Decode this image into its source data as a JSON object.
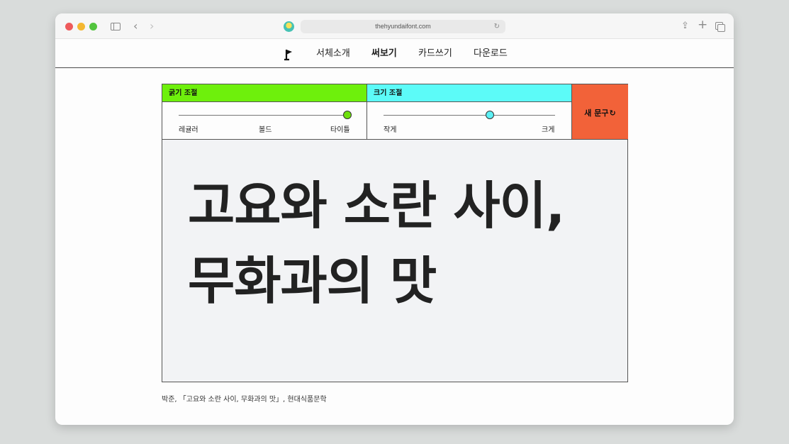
{
  "browser": {
    "url": "thehyundaifont.com"
  },
  "nav": {
    "items": [
      {
        "label": "서체소개",
        "active": false
      },
      {
        "label": "써보기",
        "active": true
      },
      {
        "label": "카드쓰기",
        "active": false
      },
      {
        "label": "다운로드",
        "active": false
      }
    ]
  },
  "controls": {
    "weight": {
      "title": "굵기 조절",
      "labels": [
        "레귤러",
        "볼드",
        "타이틀"
      ],
      "value_fraction": 1.0,
      "color": "#6ef00c"
    },
    "size": {
      "title": "크기 조절",
      "labels": [
        "작게",
        "크게"
      ],
      "value_fraction": 0.62,
      "color": "#5cfbf8"
    },
    "new_text_button": {
      "label": "새 문구",
      "color": "#f26239"
    }
  },
  "preview": {
    "lines": [
      "고요와 소란 사이,",
      "무화과의 맛"
    ]
  },
  "caption": "박준, 「고요와 소란 사이, 무화과의 맛」, 현대식품문학"
}
